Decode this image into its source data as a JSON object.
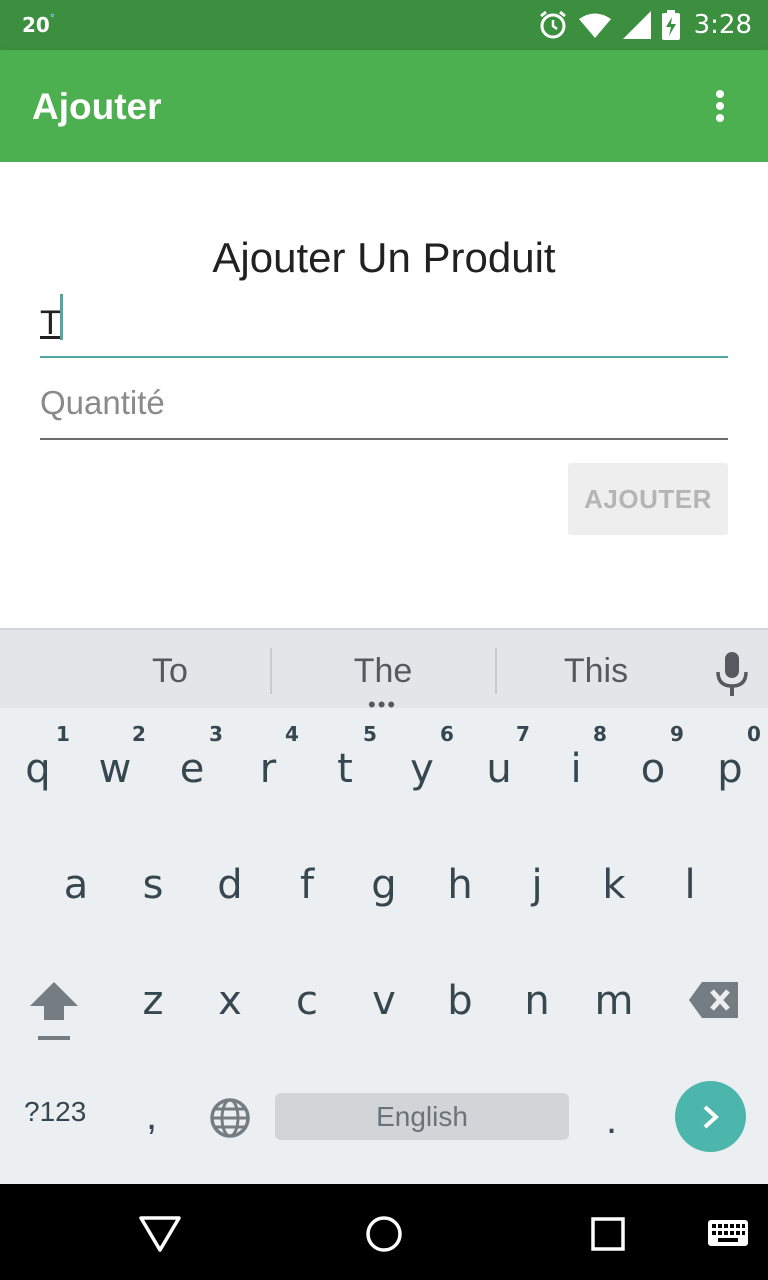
{
  "status_bar": {
    "temperature": "20",
    "degree": "°",
    "time": "3:28",
    "icons": [
      "alarm-icon",
      "wifi-icon",
      "signal-icon",
      "battery-charging-icon"
    ]
  },
  "app_bar": {
    "title": "Ajouter",
    "overflow_icon": "more-vert-icon"
  },
  "form": {
    "heading": "Ajouter Un Produit",
    "name_value": "T",
    "quantity_placeholder": "Quantité",
    "submit_label": "AJOUTER"
  },
  "colors": {
    "status_bar": "#3c8f3f",
    "app_bar": "#4caf50",
    "accent": "#4fa79f",
    "enter_key": "#4db6ac"
  },
  "keyboard": {
    "suggestions": [
      "To",
      "The",
      "This"
    ],
    "more_suggestions": "•••",
    "row1": [
      {
        "key": "q",
        "hint": "1"
      },
      {
        "key": "w",
        "hint": "2"
      },
      {
        "key": "e",
        "hint": "3"
      },
      {
        "key": "r",
        "hint": "4"
      },
      {
        "key": "t",
        "hint": "5"
      },
      {
        "key": "y",
        "hint": "6"
      },
      {
        "key": "u",
        "hint": "7"
      },
      {
        "key": "i",
        "hint": "8"
      },
      {
        "key": "o",
        "hint": "9"
      },
      {
        "key": "p",
        "hint": "0"
      }
    ],
    "row2": [
      "a",
      "s",
      "d",
      "f",
      "g",
      "h",
      "j",
      "k",
      "l"
    ],
    "row3": [
      "z",
      "x",
      "c",
      "v",
      "b",
      "n",
      "m"
    ],
    "symbols_label": "?123",
    "comma": ",",
    "space_label": "English",
    "period": ".",
    "icons": [
      "mic-icon",
      "shift-icon",
      "backspace-icon",
      "globe-icon",
      "enter-arrow-icon"
    ]
  },
  "nav_bar": {
    "icons": [
      "back-icon",
      "home-icon",
      "recents-icon",
      "keyboard-switch-icon"
    ]
  }
}
